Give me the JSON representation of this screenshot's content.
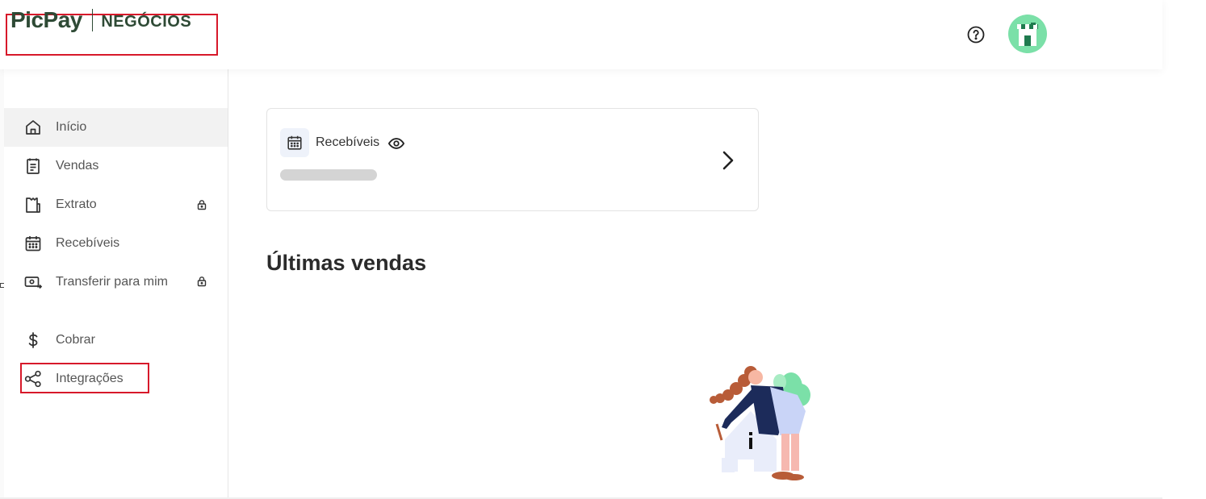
{
  "header": {
    "logo_brand": "PicPay",
    "logo_product": "NEGÓCIOS",
    "help_icon": "help-circle-icon",
    "avatar_icon": "store-avatar-icon"
  },
  "sidebar": {
    "items": [
      {
        "label": "Início",
        "icon": "home-icon",
        "active": true,
        "locked": false
      },
      {
        "label": "Vendas",
        "icon": "receipt-icon",
        "active": false,
        "locked": false
      },
      {
        "label": "Extrato",
        "icon": "statement-icon",
        "active": false,
        "locked": true
      },
      {
        "label": "Recebíveis",
        "icon": "calendar-icon",
        "active": false,
        "locked": false
      },
      {
        "label": "Transferir para mim",
        "icon": "transfer-money-icon",
        "active": false,
        "locked": true
      },
      {
        "label": "Cobrar",
        "icon": "dollar-icon",
        "active": false,
        "locked": false
      },
      {
        "label": "Integrações",
        "icon": "share-nodes-icon",
        "active": false,
        "locked": false
      }
    ],
    "lock_icon": "lock-icon"
  },
  "card": {
    "title": "Recebíveis",
    "icon": "calendar-icon",
    "visibility_icon": "eye-icon",
    "action_icon": "chevron-right-icon"
  },
  "main": {
    "section_title": "Últimas vendas",
    "empty_illustration": "person-with-house-illustration"
  },
  "colors": {
    "brand": "#2e4a35",
    "highlight_border": "#d7192a",
    "avatar_bg": "#7be0a8",
    "active_item_bg": "#f2f2f2"
  }
}
